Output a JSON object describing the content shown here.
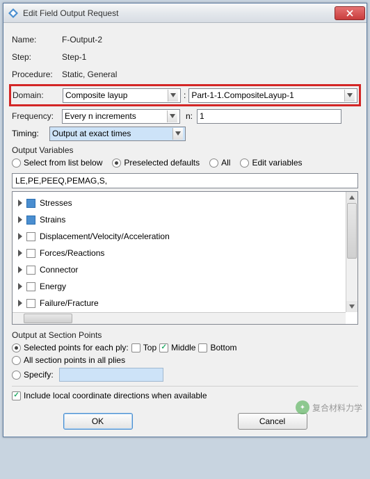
{
  "title": "Edit Field Output Request",
  "info": {
    "name_label": "Name:",
    "name_value": "F-Output-2",
    "step_label": "Step:",
    "step_value": "Step-1",
    "proc_label": "Procedure:",
    "proc_value": "Static, General"
  },
  "domain": {
    "label": "Domain:",
    "type": "Composite layup",
    "target": "Part-1-1.CompositeLayup-1"
  },
  "frequency": {
    "label": "Frequency:",
    "mode": "Every n increments",
    "n_label": "n:",
    "n_value": "1"
  },
  "timing": {
    "label": "Timing:",
    "value": "Output at exact times"
  },
  "output_vars": {
    "title": "Output Variables",
    "radios": {
      "list": "Select from list below",
      "presel": "Preselected defaults",
      "all": "All",
      "edit": "Edit variables"
    },
    "selected_radio": "presel",
    "value": "LE,PE,PEEQ,PEMAG,S,",
    "tree": [
      {
        "label": "Stresses",
        "state": "partial"
      },
      {
        "label": "Strains",
        "state": "partial"
      },
      {
        "label": "Displacement/Velocity/Acceleration",
        "state": "none"
      },
      {
        "label": "Forces/Reactions",
        "state": "none"
      },
      {
        "label": "Connector",
        "state": "none"
      },
      {
        "label": "Energy",
        "state": "none"
      },
      {
        "label": "Failure/Fracture",
        "state": "none"
      }
    ]
  },
  "section_points": {
    "title": "Output at Section Points",
    "opt_selected": "Selected points for each ply:",
    "top": "Top",
    "middle": "Middle",
    "bottom": "Bottom",
    "opt_all": "All section points in all plies",
    "opt_specify": "Specify:"
  },
  "include_local": "Include local coordinate directions when available",
  "buttons": {
    "ok": "OK",
    "cancel": "Cancel"
  },
  "watermark": "复合材料力学"
}
